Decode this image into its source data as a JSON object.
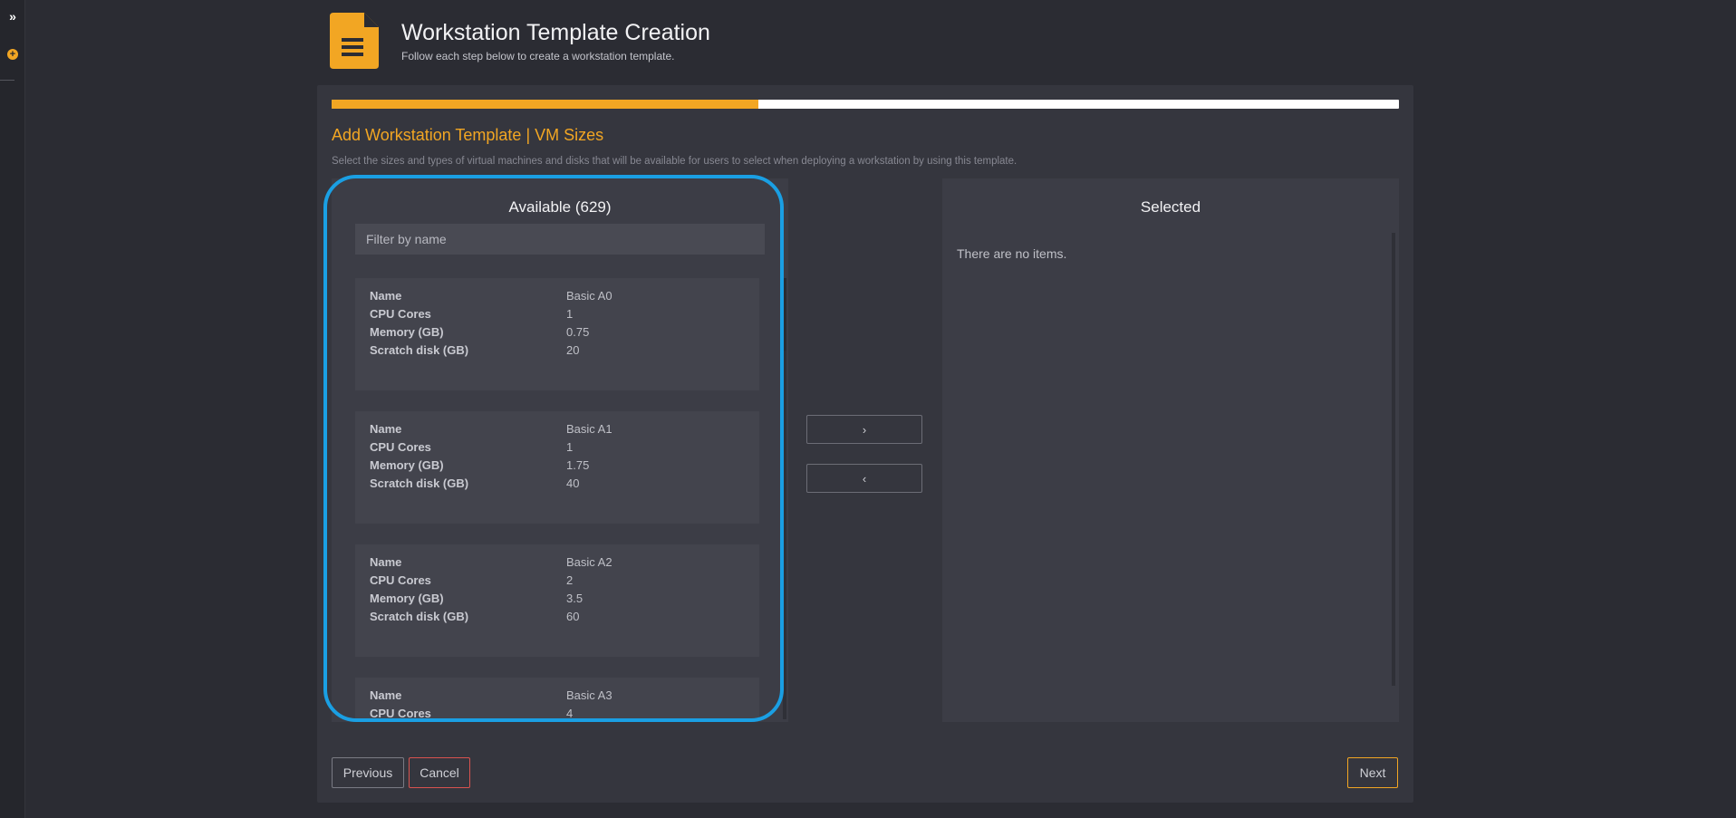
{
  "sidebar": {
    "expand_icon": "chevron-double-right-icon",
    "add_icon": "plus-circle-icon"
  },
  "header": {
    "icon": "document-icon",
    "title": "Workstation Template Creation",
    "subtitle": "Follow each step below to create a workstation template."
  },
  "progress": {
    "percent": 40
  },
  "step": {
    "title": "Add Workstation Template | VM Sizes",
    "description": "Select the sizes and types of virtual machines and disks that will be available for users to select when deploying a workstation by using this template."
  },
  "available": {
    "title": "Available (629)",
    "filter_placeholder": "Filter by name",
    "labels": {
      "name": "Name",
      "cores": "CPU Cores",
      "memory": "Memory (GB)",
      "disk": "Scratch disk (GB)"
    },
    "items": [
      {
        "name": "Basic A0",
        "cores": "1",
        "memory": "0.75",
        "disk": "20"
      },
      {
        "name": "Basic A1",
        "cores": "1",
        "memory": "1.75",
        "disk": "40"
      },
      {
        "name": "Basic A2",
        "cores": "2",
        "memory": "3.5",
        "disk": "60"
      },
      {
        "name": "Basic A3",
        "cores": "4"
      }
    ]
  },
  "transfer": {
    "add_label": "›",
    "remove_label": "‹"
  },
  "selected": {
    "title": "Selected",
    "empty_text": "There are no items."
  },
  "footer": {
    "previous_label": "Previous",
    "cancel_label": "Cancel",
    "next_label": "Next"
  },
  "colors": {
    "accent": "#f2a623",
    "highlight": "#1a9fe3",
    "danger": "#d9534f"
  }
}
